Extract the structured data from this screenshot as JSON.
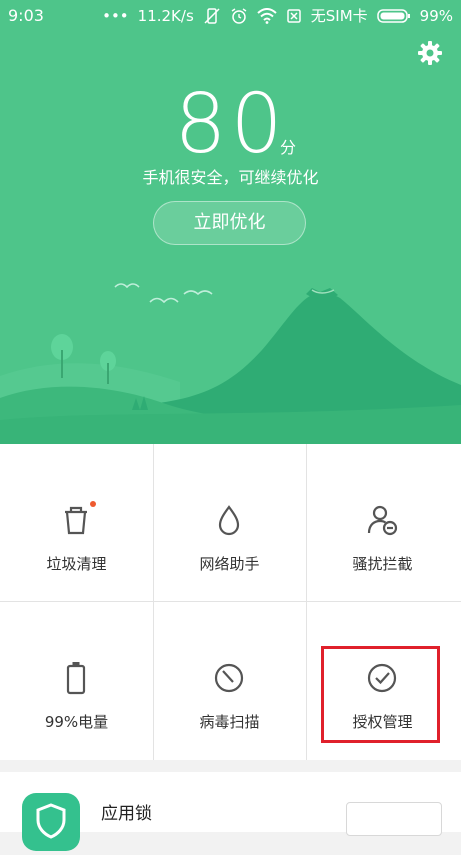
{
  "status_bar": {
    "time": "9:03",
    "dots": "•••",
    "speed": "11.2K/s",
    "sim": "无SIM卡",
    "battery": "99%"
  },
  "hero": {
    "score": "80",
    "score_unit": "分",
    "subtitle": "手机很安全，可继续优化",
    "optimize_label": "立即优化",
    "settings_icon": "gear-icon",
    "background_color": "#4ec58a"
  },
  "grid": {
    "items": [
      {
        "label": "垃圾清理",
        "icon": "trash-icon",
        "badge": true
      },
      {
        "label": "网络助手",
        "icon": "droplet-icon"
      },
      {
        "label": "骚扰拦截",
        "icon": "block-user-icon"
      },
      {
        "label": "99%电量",
        "icon": "battery-icon"
      },
      {
        "label": "病毒扫描",
        "icon": "scan-icon"
      },
      {
        "label": "授权管理",
        "icon": "check-circle-icon"
      }
    ],
    "highlight_color": "#e0202b"
  },
  "app_lock": {
    "title": "应用锁",
    "button_label": "",
    "icon": "shield-lock-icon",
    "icon_color": "#34c18e"
  }
}
